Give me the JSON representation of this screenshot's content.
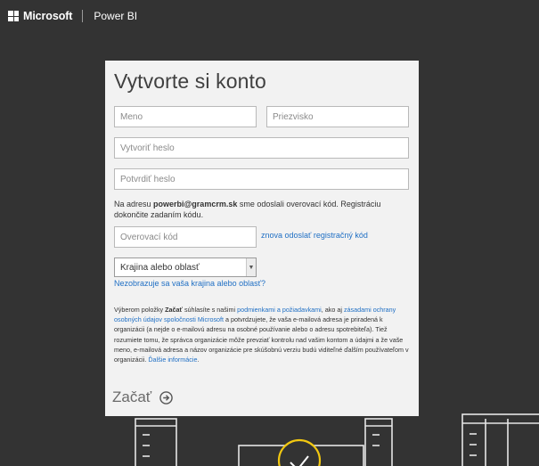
{
  "header": {
    "brand": "Microsoft",
    "product": "Power BI"
  },
  "form": {
    "title": "Vytvorte si konto",
    "first_name_placeholder": "Meno",
    "last_name_placeholder": "Priezvisko",
    "password_placeholder": "Vytvoriť heslo",
    "confirm_password_placeholder": "Potvrdiť heslo",
    "info_prefix": "Na adresu ",
    "info_email": "powerbi@gramcrm.sk",
    "info_suffix": " sme odoslali overovací kód. Registráciu dokončite zadaním kódu.",
    "code_placeholder": "Overovací kód",
    "resend_link": "znova odoslať registračný kód",
    "country_selected": "Krajina alebo oblasť",
    "country_missing_link": "Nezobrazuje sa vaša krajina alebo oblasť?",
    "legal_1": "Výberom položky ",
    "legal_start_word": "Začať",
    "legal_2": " súhlasíte s našimi ",
    "legal_terms_link": "podmienkami a požiadavkami",
    "legal_3": ", ako aj ",
    "legal_privacy_link": "zásadami ochrany osobných údajov spoločnosti Microsoft",
    "legal_4": " a potvrdzujete, že vaša e-mailová adresa je priradená k organizácii (a nejde o e-mailovú adresu na osobné používanie alebo o adresu spotrebiteľa). Tiež rozumiete tomu, že správca organizácie môže prevziať kontrolu nad vašim kontom a údajmi a že vaše meno, e-mailová adresa a názov organizácie pre skúšobnú verziu budú viditeľné ďalším používateľom v organizácii. ",
    "legal_more_link": "Ďalšie informácie",
    "legal_end": ".",
    "start_button": "Začať"
  },
  "colors": {
    "background": "#333333",
    "card": "#f2f2f2",
    "link": "#1f6fc4",
    "accent_yellow": "#f2c811"
  },
  "icons": {
    "start": "arrow-right-circle-icon",
    "logo": "microsoft-logo-icon",
    "dropdown": "chevron-down-icon"
  }
}
